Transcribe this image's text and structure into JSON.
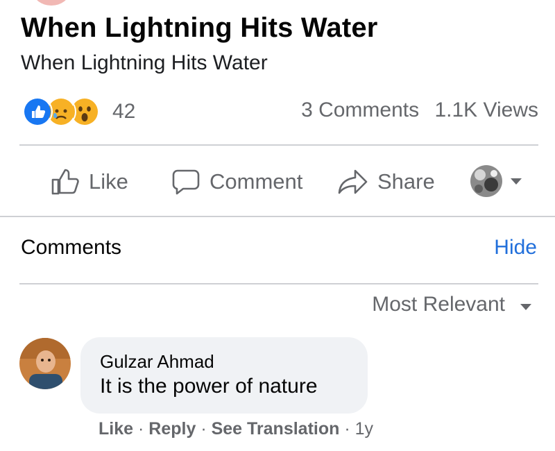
{
  "post": {
    "title": "When Lightning Hits Water",
    "subtitle": "When Lightning Hits Water",
    "reactions": {
      "icons": [
        "like-icon",
        "sad-icon",
        "wow-icon"
      ],
      "count": "42"
    },
    "comments_count": "3 Comments",
    "views": "1.1K Views"
  },
  "actions": {
    "like": "Like",
    "comment": "Comment",
    "share": "Share"
  },
  "comments_section": {
    "title": "Comments",
    "hide": "Hide",
    "sort": "Most Relevant",
    "items": [
      {
        "author": "Gulzar Ahmad",
        "text": "It is the power of nature",
        "like": "Like",
        "reply": "Reply",
        "see_translation": "See Translation",
        "time": "1y"
      }
    ]
  },
  "colors": {
    "link_blue": "#216fdb",
    "secondary_text": "#65676b",
    "divider": "#ced0d4",
    "bubble": "#f0f2f5"
  }
}
